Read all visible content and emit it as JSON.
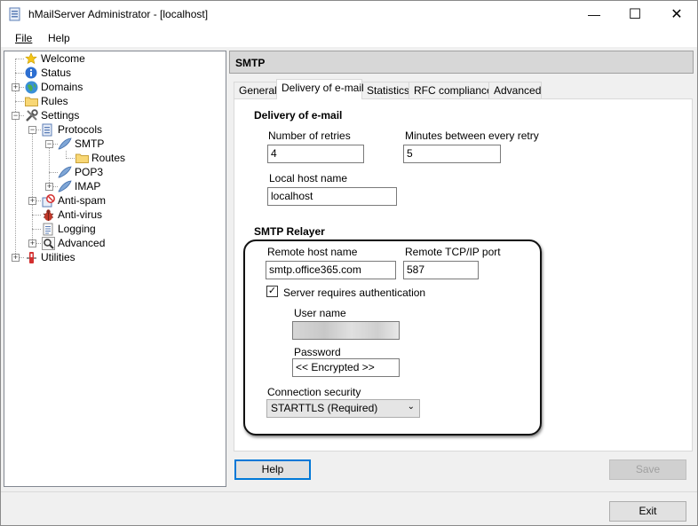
{
  "window": {
    "title": "hMailServer Administrator - [localhost]",
    "controls": {
      "minimize": "—",
      "maximize": "☐",
      "close": "✕"
    }
  },
  "menu": {
    "file": "File",
    "help": "Help"
  },
  "tree": {
    "welcome": "Welcome",
    "status": "Status",
    "domains": "Domains",
    "rules": "Rules",
    "settings": "Settings",
    "protocols": "Protocols",
    "smtp": "SMTP",
    "routes": "Routes",
    "pop3": "POP3",
    "imap": "IMAP",
    "antispam": "Anti-spam",
    "antivirus": "Anti-virus",
    "logging": "Logging",
    "advanced": "Advanced",
    "utilities": "Utilities",
    "expander_plus": "+",
    "expander_minus": "−"
  },
  "panel": {
    "header": "SMTP",
    "tabs": [
      "General",
      "Delivery of e-mail",
      "Statistics",
      "RFC compliance",
      "Advanced"
    ]
  },
  "delivery": {
    "section": "Delivery of e-mail",
    "retries_label": "Number of retries",
    "retries_value": "4",
    "minutes_label": "Minutes between every retry",
    "minutes_value": "5",
    "localhost_label": "Local host name",
    "localhost_value": "localhost"
  },
  "relayer": {
    "section": "SMTP Relayer",
    "host_label": "Remote host name",
    "host_value": "smtp.office365.com",
    "port_label": "Remote TCP/IP port",
    "port_value": "587",
    "auth_label": "Server requires authentication",
    "auth_checked": "✓",
    "user_label": "User name",
    "password_label": "Password",
    "password_value": "<< Encrypted >>",
    "security_label": "Connection security",
    "security_value": "STARTTLS (Required)",
    "security_arrow": "⌄"
  },
  "buttons": {
    "help": "Help",
    "save": "Save",
    "exit": "Exit"
  }
}
